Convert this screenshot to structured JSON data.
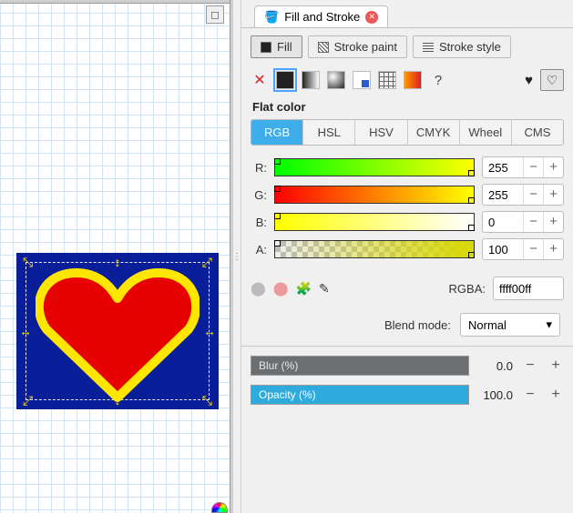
{
  "dock": {
    "tab_label": "Fill and Stroke"
  },
  "tabs": {
    "fill": "Fill",
    "stroke_paint": "Stroke paint",
    "stroke_style": "Stroke style"
  },
  "paint": {
    "section": "Flat color",
    "unknown": "?"
  },
  "modes": {
    "rgb": "RGB",
    "hsl": "HSL",
    "hsv": "HSV",
    "cmyk": "CMYK",
    "wheel": "Wheel",
    "cms": "CMS"
  },
  "channels": {
    "r": {
      "label": "R:",
      "value": "255"
    },
    "g": {
      "label": "G:",
      "value": "255"
    },
    "b": {
      "label": "B:",
      "value": "0"
    },
    "a": {
      "label": "A:",
      "value": "100"
    }
  },
  "rgba": {
    "label": "RGBA:",
    "value": "ffff00ff"
  },
  "blend": {
    "label": "Blend mode:",
    "value": "Normal"
  },
  "blur": {
    "label": "Blur (%)",
    "value": "0.0"
  },
  "opacity": {
    "label": "Opacity (%)",
    "value": "100.0"
  }
}
